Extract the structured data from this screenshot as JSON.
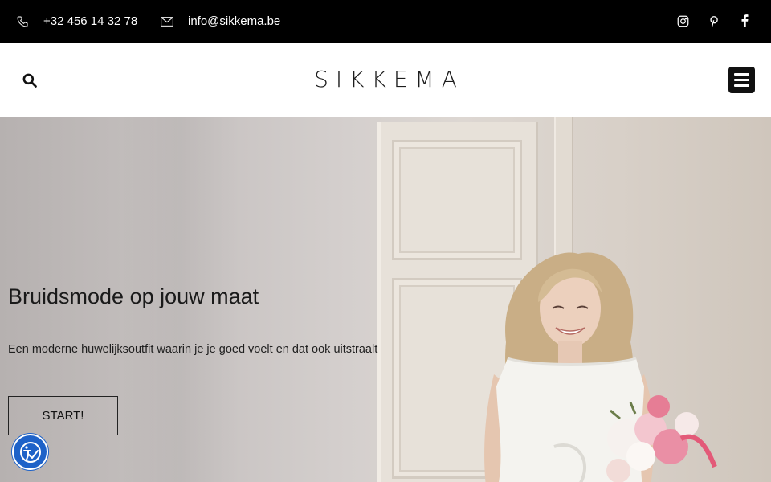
{
  "topbar": {
    "phone": "+32 456 14 32 78",
    "email": "info@sikkema.be",
    "social": [
      "instagram-icon",
      "pinterest-icon",
      "facebook-icon"
    ]
  },
  "header": {
    "logo": "SIKKEMA",
    "icons": [
      "search-icon",
      "menu-icon"
    ]
  },
  "hero": {
    "title": "Bruidsmode op jouw maat",
    "subtitle": "Een moderne huwelijksoutfit waarin je je goed voelt en dat ook uitstraalt",
    "cta": "START!"
  },
  "accessibility": {
    "icon": "accessibility-icon"
  },
  "colors": {
    "topbar": "#000000",
    "accent": "#1e62c8",
    "text": "#1a1a1a"
  }
}
